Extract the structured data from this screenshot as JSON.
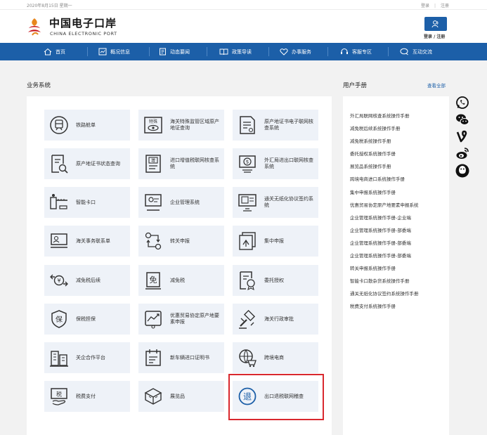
{
  "topbar": {
    "date": "2020年8月15日 星期一",
    "login": "登录",
    "register": "注册"
  },
  "header": {
    "logo_cn": "中国电子口岸",
    "logo_en": "CHINA ELECTRONIC PORT",
    "login_register": "登录 / 注册"
  },
  "nav": [
    {
      "label": "首页",
      "icon": "home-icon"
    },
    {
      "label": "概况信息",
      "icon": "chart-icon"
    },
    {
      "label": "动态要闻",
      "icon": "news-icon"
    },
    {
      "label": "政策导读",
      "icon": "book-icon"
    },
    {
      "label": "办事服务",
      "icon": "heart-icon"
    },
    {
      "label": "客服专区",
      "icon": "headset-icon"
    },
    {
      "label": "互动交流",
      "icon": "chat-icon"
    }
  ],
  "business": {
    "title": "业务系统",
    "tiles": [
      {
        "label": "铁路舱单",
        "icon": "train-icon"
      },
      {
        "label": "海关特殊监管区域原产地证查询",
        "icon": "special-zone-icon"
      },
      {
        "label": "原产地证书电子联网核查系统",
        "icon": "certificate-icon"
      },
      {
        "label": "原产地证书状态查询",
        "icon": "search-document-icon"
      },
      {
        "label": "进口增值税联网核查系统",
        "icon": "vat-icon"
      },
      {
        "label": "外汇局进出口联网核查系统",
        "icon": "forex-icon"
      },
      {
        "label": "智能卡口",
        "icon": "gate-icon"
      },
      {
        "label": "企业管理系统",
        "icon": "enterprise-icon"
      },
      {
        "label": "通关无纸化协议签约系统",
        "icon": "paperless-icon"
      },
      {
        "label": "海关事务联系单",
        "icon": "contact-form-icon"
      },
      {
        "label": "转关申报",
        "icon": "transfer-icon"
      },
      {
        "label": "集中申报",
        "icon": "centralized-icon"
      },
      {
        "label": "减免税后续",
        "icon": "tax-reduction-icon"
      },
      {
        "label": "减免税",
        "icon": "exemption-icon"
      },
      {
        "label": "委托授权",
        "icon": "authorization-icon"
      },
      {
        "label": "保税担保",
        "icon": "bond-guarantee-icon"
      },
      {
        "label": "优惠贸易协定原产地要素申报",
        "icon": "trade-agreement-icon"
      },
      {
        "label": "海关行政审批",
        "icon": "approval-icon"
      },
      {
        "label": "关企合作平台",
        "icon": "cooperation-icon"
      },
      {
        "label": "新车辆进口证明书",
        "icon": "vehicle-cert-icon"
      },
      {
        "label": "跨境电商",
        "icon": "ecommerce-icon"
      },
      {
        "label": "税费支付",
        "icon": "payment-icon"
      },
      {
        "label": "展览品",
        "icon": "exhibition-icon"
      },
      {
        "label": "出口退税联网稽查",
        "icon": "refund-icon"
      }
    ]
  },
  "manual": {
    "title": "用户手册",
    "view_all": "查看全部",
    "items": [
      "外汇局联网核查系统操作手册",
      "减免税后续系统操作手册",
      "减免税系统操作手册",
      "委托授权系统操作手册",
      "展览品系统操作手册",
      "跨境电商进口系统操作手册",
      "集中申报系统操作手册",
      "优惠贸易协定原产地要素申报系统",
      "企业管理系统操作手册-企业端",
      "企业管理系统操作手册-部委端",
      "企业管理系统操作手册-部委端",
      "企业管理系统操作手册-部委端",
      "转关申报系统操作手册",
      "智能卡口散杂货系统操作手册",
      "通关无纸化协议签约系统操作手册",
      "税费支付系统操作手册"
    ]
  },
  "side_icons": [
    "whatsapp-icon",
    "wechat-icon",
    "vine-icon",
    "weibo-icon",
    "qq-icon"
  ],
  "colors": {
    "brand_blue": "#1c5fa8",
    "tile_bg": "#eef2f8",
    "highlight_red": "#d9282e",
    "logo_orange": "#e8871e",
    "logo_red": "#c8161d"
  }
}
